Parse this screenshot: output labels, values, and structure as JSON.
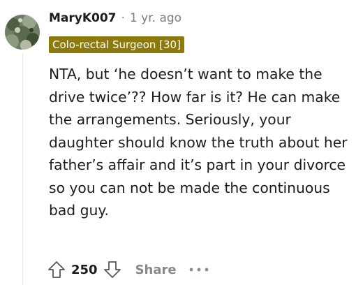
{
  "comment": {
    "author": "MaryK007",
    "separator": "·",
    "timestamp": "1 yr. ago",
    "flair": "Colo-rectal Surgeon [30]",
    "flair_color": "#8d7a0c",
    "avatar": "snoo-avatar",
    "body": "NTA, but ‘he doesn’t want to make the drive twice’?? How far is it? He can make the arrangements. Seriously, your daughter should know the truth about her father’s affair and it’s part in your divorce so you can not be made the continuous bad guy."
  },
  "actions": {
    "upvote_icon": "upvote-arrow-icon",
    "vote_count": "250",
    "downvote_icon": "downvote-arrow-icon",
    "share_label": "Share",
    "more_icon": "more-options-icon"
  }
}
